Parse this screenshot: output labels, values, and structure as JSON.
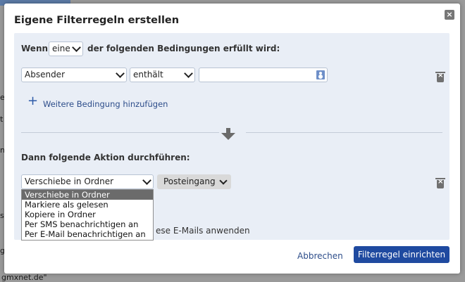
{
  "background": {
    "left_chars": [
      "e",
      "t",
      "n",
      "s",
      "g"
    ],
    "footer_text": "gmxnet.de\""
  },
  "dialog": {
    "title": "Eigene Filterregeln erstellen",
    "close_label": "×"
  },
  "condition": {
    "prefix": "Wenn",
    "match_mode": "eine",
    "suffix": "der folgenden Bedingungen erfüllt wird:",
    "field_value": "Absender",
    "operator_value": "enthält",
    "text_value": "",
    "add_label": "Weitere Bedingung hinzufügen"
  },
  "action": {
    "heading": "Dann folgende Aktion durchführen:",
    "action_value": "Verschiebe in Ordner",
    "folder_value": "Posteingang",
    "apply_text_visible": "ese E-Mails anwenden",
    "options": [
      "Verschiebe in Ordner",
      "Markiere als gelesen",
      "Kopiere in Ordner",
      "Per SMS benachrichtigen an",
      "Per E-Mail benachrichtigen an"
    ],
    "selected_index": 0
  },
  "footer": {
    "cancel_label": "Abbrechen",
    "submit_label": "Filterregel einrichten"
  },
  "colors": {
    "accent": "#1f4aa0",
    "panel": "#e9eef6",
    "link": "#2d4d8a",
    "selected_option": "#6b6b6b"
  },
  "icons": [
    "close-icon",
    "address-book-icon",
    "trash-icon",
    "plus-icon",
    "arrow-down-icon",
    "chevron-down-icon"
  ]
}
